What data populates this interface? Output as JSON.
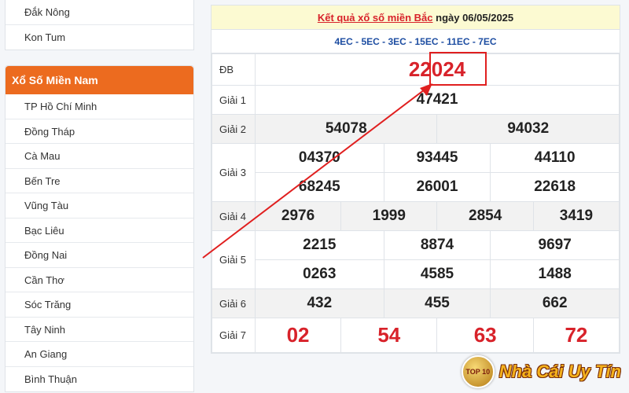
{
  "sidebar": {
    "top_items": [
      "Đắk Nông",
      "Kon Tum"
    ],
    "south_header": "Xổ Số Miền Nam",
    "south_items": [
      "TP Hồ Chí Minh",
      "Đồng Tháp",
      "Cà Mau",
      "Bến Tre",
      "Vũng Tàu",
      "Bạc Liêu",
      "Đồng Nai",
      "Cần Thơ",
      "Sóc Trăng",
      "Tây Ninh",
      "An Giang",
      "Bình Thuận"
    ]
  },
  "results": {
    "title_link": "Kết quả xổ số miền Bắc",
    "title_date": "ngày 06/05/2025",
    "codes": "4EC - 5EC - 3EC - 15EC - 11EC - 7EC",
    "labels": {
      "db": "ĐB",
      "g1": "Giải 1",
      "g2": "Giải 2",
      "g3": "Giải 3",
      "g4": "Giải 4",
      "g5": "Giải 5",
      "g6": "Giải 6",
      "g7": "Giải 7"
    },
    "db": "22024",
    "g1": "47421",
    "g2": [
      "54078",
      "94032"
    ],
    "g3": [
      "04370",
      "93445",
      "44110",
      "68245",
      "26001",
      "22618"
    ],
    "g4": [
      "2976",
      "1999",
      "2854",
      "3419"
    ],
    "g5": [
      "2215",
      "8874",
      "9697",
      "0263",
      "4585",
      "1488"
    ],
    "g6": [
      "432",
      "455",
      "662"
    ],
    "g7": [
      "02",
      "54",
      "63",
      "72"
    ]
  },
  "watermark": {
    "badge": "TOP 10",
    "text": "Nhà Cái Uy Tín"
  },
  "colors": {
    "accent_orange": "#ec6b1f",
    "prize_red": "#d8222a",
    "code_blue": "#1e4ea2",
    "title_bg": "#fcfad2"
  }
}
